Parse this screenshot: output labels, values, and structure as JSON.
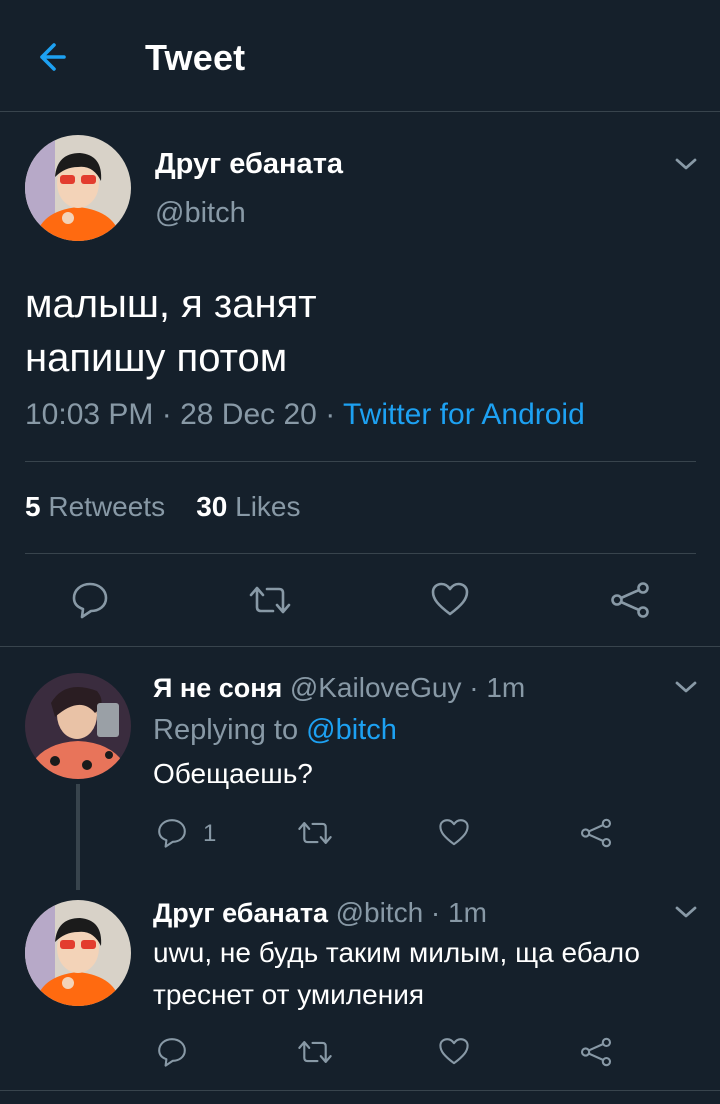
{
  "header": {
    "title": "Tweet",
    "back_icon": "arrow-left-icon"
  },
  "colors": {
    "background": "#15202b",
    "accent": "#1da1f2",
    "muted": "#8899a6",
    "divider": "#38444d"
  },
  "tweet": {
    "author_name": "Друг ебаната",
    "handle": "@bitch",
    "text_lines": [
      "малыш, я занят",
      "напишу потом"
    ],
    "time": "10:03 PM",
    "date": "28 Dec 20",
    "source": "Twitter for Android",
    "retweets_count": "5",
    "retweets_label": "Retweets",
    "likes_count": "30",
    "likes_label": "Likes"
  },
  "replies": [
    {
      "author_name": "Я не соня",
      "handle": "@KailoveGuy",
      "time": "1m",
      "replying_prefix": "Replying to",
      "replying_to": "@bitch",
      "text": "Обещаешь?",
      "reply_count": "1"
    },
    {
      "author_name": "Друг ебаната",
      "handle": "@bitch",
      "time": "1m",
      "text": "uwu, не будь таким милым, ща ебало треснет от умиления"
    }
  ]
}
